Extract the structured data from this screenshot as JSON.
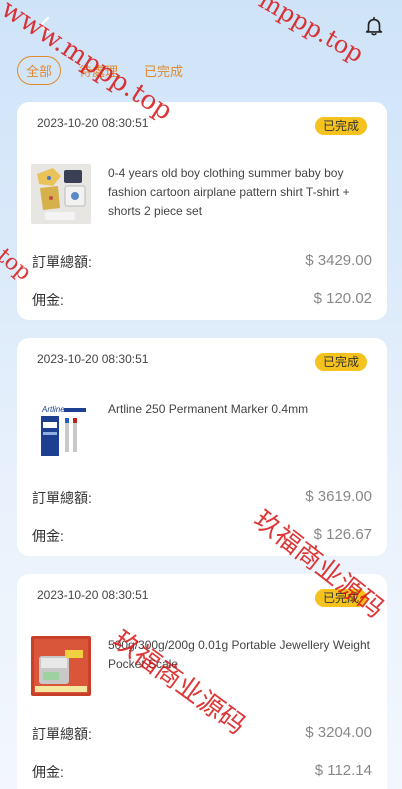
{
  "nav": {
    "back_icon": "back-arrow-icon",
    "bell_icon": "bell-icon"
  },
  "tabs": [
    {
      "label": "全部",
      "active": true
    },
    {
      "label": "待處理",
      "active": false
    },
    {
      "label": "已完成",
      "active": false
    }
  ],
  "labels": {
    "total": "訂單總額:",
    "commission": "佣金:"
  },
  "orders": [
    {
      "date": "2023-10-20 08:30:51",
      "status": "已完成",
      "name": "0-4 years old boy clothing summer baby boy fashion cartoon airplane pattern shirt T-shirt + shorts 2 piece set",
      "total": "$ 3429.00",
      "commission": "$ 120.02"
    },
    {
      "date": "2023-10-20 08:30:51",
      "status": "已完成",
      "name": "Artline 250 Permanent Marker 0.4mm",
      "total": "$ 3619.00",
      "commission": "$ 126.67"
    },
    {
      "date": "2023-10-20 08:30:51",
      "status": "已完成",
      "name": "500g/300g/200g 0.01g Portable Jewellery Weight Pocket Scale",
      "total": "$ 3204.00",
      "commission": "$ 112.14"
    }
  ],
  "watermarks": {
    "url_top": "www.mppp.top",
    "url_mid": "mppp.top",
    "url_left": "p.top",
    "brand": "玖福商业源码"
  },
  "colors": {
    "accent": "#e08a2f",
    "badge": "#f6c21d",
    "watermark": "#d71414"
  }
}
